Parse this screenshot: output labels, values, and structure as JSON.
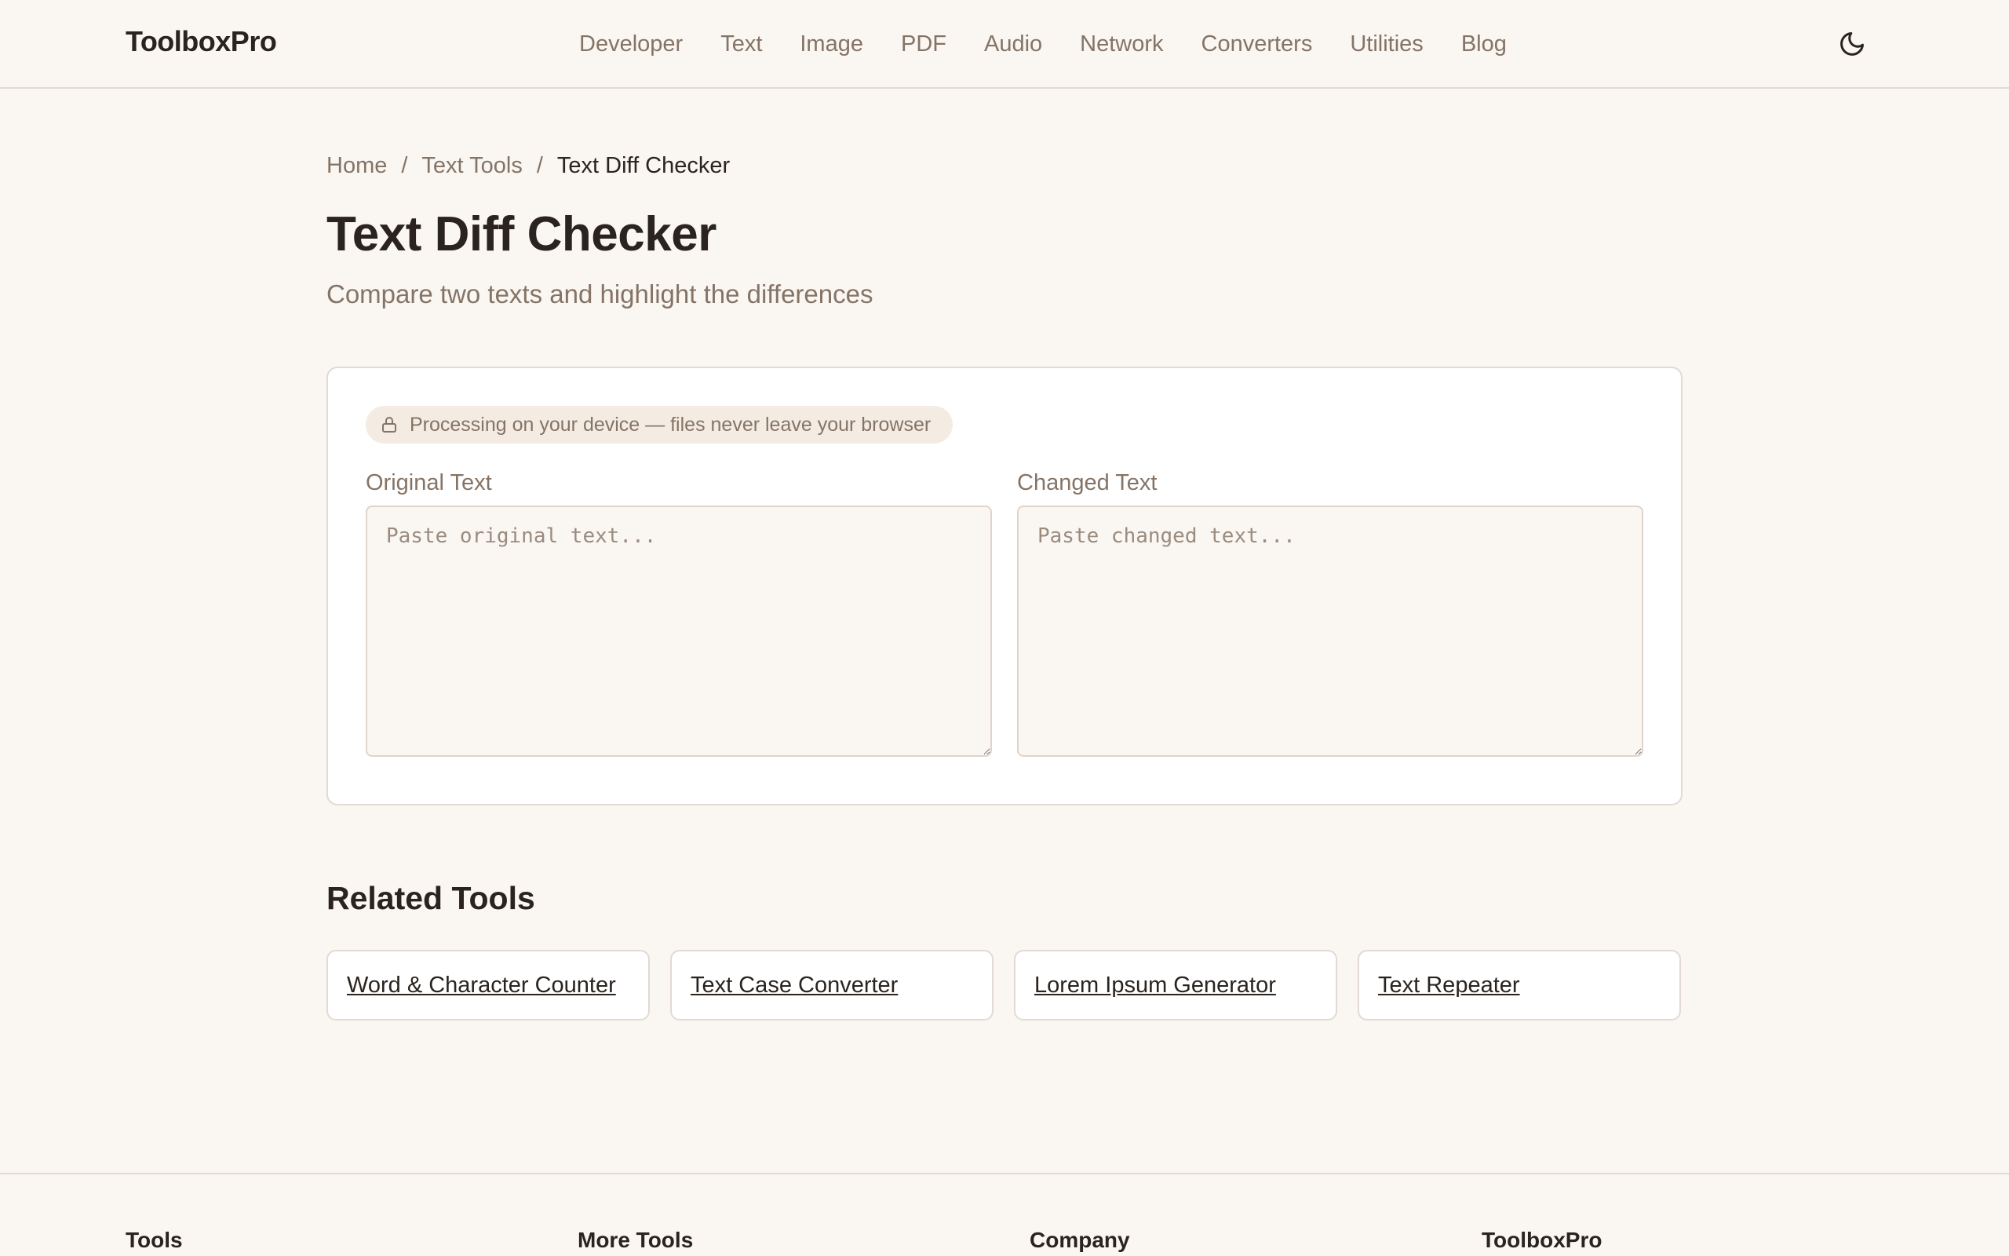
{
  "header": {
    "brand": "ToolboxPro",
    "nav": [
      "Developer",
      "Text",
      "Image",
      "PDF",
      "Audio",
      "Network",
      "Converters",
      "Utilities",
      "Blog"
    ],
    "theme_icon": "moon-icon"
  },
  "breadcrumb": {
    "home": "Home",
    "sep": "/",
    "category": "Text Tools",
    "current": "Text Diff Checker"
  },
  "page": {
    "title": "Text Diff Checker",
    "subtitle": "Compare two texts and highlight the differences"
  },
  "tool": {
    "privacy_notice": "Processing on your device — files never leave your browser",
    "privacy_icon": "lock-icon",
    "original_label": "Original Text",
    "original_placeholder": "Paste original text...",
    "changed_label": "Changed Text",
    "changed_placeholder": "Paste changed text..."
  },
  "related": {
    "title": "Related Tools",
    "items": [
      "Word & Character Counter",
      "Text Case Converter",
      "Lorem Ipsum Generator",
      "Text Repeater"
    ]
  },
  "footer": {
    "columns": [
      "Tools",
      "More Tools",
      "Company",
      "ToolboxPro"
    ]
  },
  "colors": {
    "background": "#faf6f2",
    "text": "#2a231e",
    "muted": "#857466",
    "badge_bg": "#f4ebe2",
    "border": "#e2dad3"
  }
}
